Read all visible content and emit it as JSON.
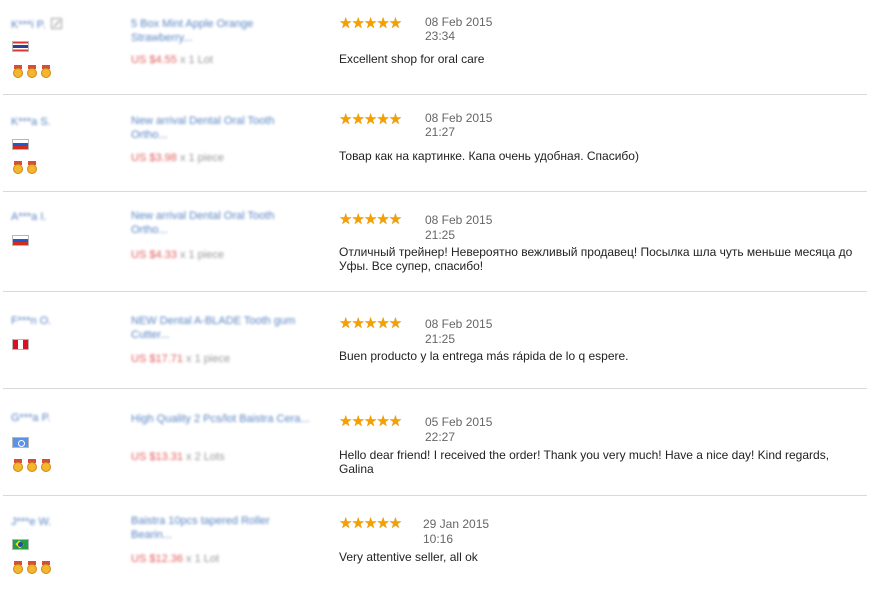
{
  "feedbacks": [
    {
      "buyer": "K***i P.",
      "country": "Thailand",
      "medal_count": 3,
      "product": "5 Box Mint Apple Orange Strawberry...",
      "price": "US $4.55",
      "quantity": "x 1 Lot",
      "stars": "★★★★★",
      "date": "08 Feb 2015",
      "time": "23:34",
      "text": "Excellent shop for oral care"
    },
    {
      "buyer": "K***a S.",
      "country": "Russian Federation",
      "medal_count": 2,
      "product": "New arrival Dental Oral Tooth Ortho...",
      "price": "US $3.98",
      "quantity": "x 1 piece",
      "stars": "★★★★★",
      "date": "08 Feb 2015",
      "time": "21:27",
      "text": "Товар как на картинке. Капа очень удобная. Спасибо)"
    },
    {
      "buyer": "A***a I.",
      "country": "Russian Federation",
      "medal_count": 0,
      "product": "New arrival Dental Oral Tooth Ortho...",
      "price": "US $4.33",
      "quantity": "x 1 piece",
      "stars": "★★★★★",
      "date": "08 Feb 2015",
      "time": "21:25",
      "text": "Отличный трейнер! Невероятно вежливый продавец! Посылка шла чуть меньше месяца до Уфы. Все супер, спасибо!"
    },
    {
      "buyer": "F***n O.",
      "country": "Peru",
      "medal_count": 0,
      "product": "NEW Dental A-BLADE Tooth gum Cutter...",
      "price": "US $17.71",
      "quantity": "x 1 piece",
      "stars": "★★★★★",
      "date": "08 Feb 2015",
      "time": "21:25",
      "text": "Buen producto y la entrega más rápida de lo q espere."
    },
    {
      "buyer": "G***a P.",
      "country": "United Nations",
      "medal_count": 3,
      "product": "High Quality 2 Pcs/lot Baistra Cera...",
      "price": "US $13.31",
      "quantity": "x 2 Lots",
      "stars": "★★★★★",
      "date": "05 Feb 2015",
      "time": "22:27",
      "text": "Hello dear friend! I received the order! Thank you very much! Have a nice day! Kind regards, Galina"
    },
    {
      "buyer": "J***e W.",
      "country": "Brazil",
      "medal_count": 3,
      "product": "Baistra 10pcs tapered Roller Bearin...",
      "price": "US $12.36",
      "quantity": "x 1 Lot",
      "stars": "★★★★★",
      "date": "29 Jan 2015",
      "time": "10:16",
      "text": "Very attentive seller, all ok"
    }
  ]
}
